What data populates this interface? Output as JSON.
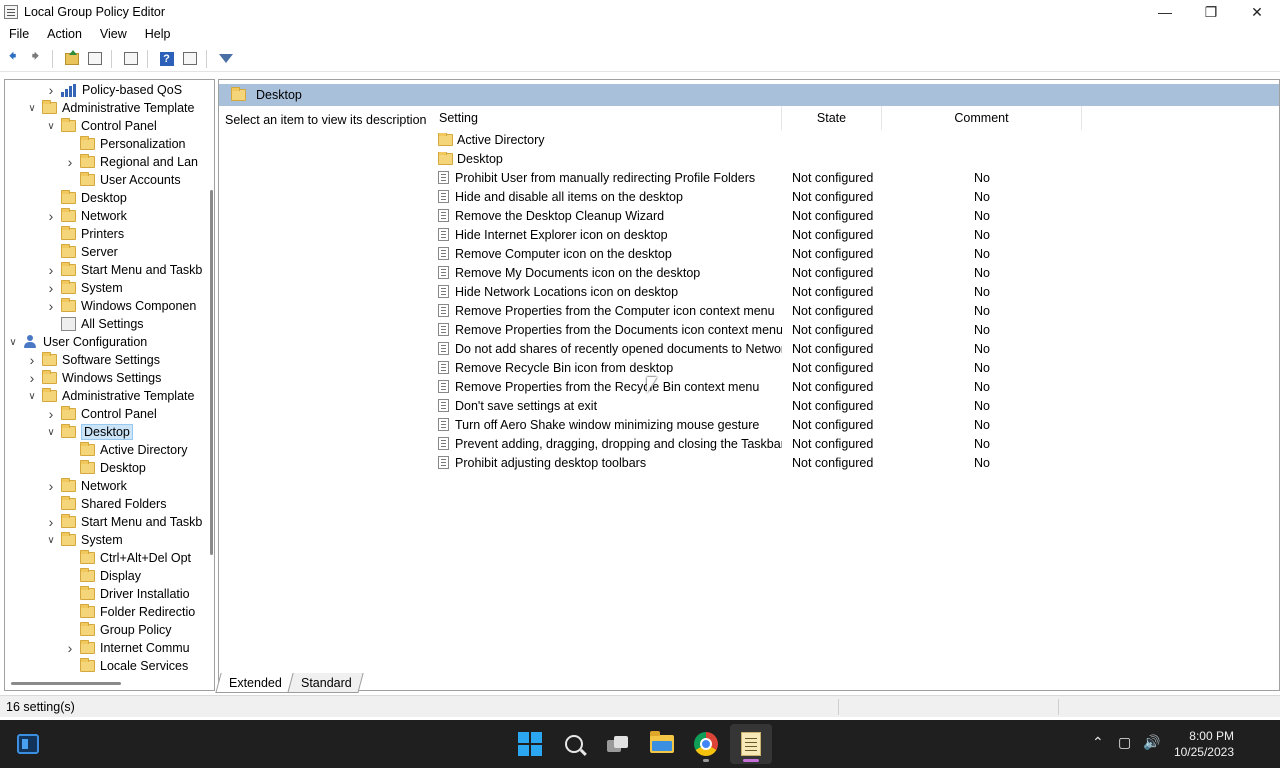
{
  "window": {
    "title": "Local Group Policy Editor"
  },
  "menu": [
    "File",
    "Action",
    "View",
    "Help"
  ],
  "tree": [
    {
      "label": "Policy-based QoS",
      "depth": 2,
      "chev": "right",
      "icon": "bars"
    },
    {
      "label": "Administrative Template",
      "depth": 1,
      "chev": "down",
      "icon": "folder"
    },
    {
      "label": "Control Panel",
      "depth": 2,
      "chev": "down",
      "icon": "folder"
    },
    {
      "label": "Personalization",
      "depth": 3,
      "chev": "",
      "icon": "folder"
    },
    {
      "label": "Regional and Lan",
      "depth": 3,
      "chev": "right",
      "icon": "folder"
    },
    {
      "label": "User Accounts",
      "depth": 3,
      "chev": "",
      "icon": "folder"
    },
    {
      "label": "Desktop",
      "depth": 2,
      "chev": "",
      "icon": "folder"
    },
    {
      "label": "Network",
      "depth": 2,
      "chev": "right",
      "icon": "folder"
    },
    {
      "label": "Printers",
      "depth": 2,
      "chev": "",
      "icon": "folder"
    },
    {
      "label": "Server",
      "depth": 2,
      "chev": "",
      "icon": "folder"
    },
    {
      "label": "Start Menu and Taskb",
      "depth": 2,
      "chev": "right",
      "icon": "folder"
    },
    {
      "label": "System",
      "depth": 2,
      "chev": "right",
      "icon": "folder"
    },
    {
      "label": "Windows Componen",
      "depth": 2,
      "chev": "right",
      "icon": "folder"
    },
    {
      "label": "All Settings",
      "depth": 2,
      "chev": "",
      "icon": "allsettings"
    },
    {
      "label": "User Configuration",
      "depth": 0,
      "chev": "down",
      "icon": "user"
    },
    {
      "label": "Software Settings",
      "depth": 1,
      "chev": "right",
      "icon": "folder"
    },
    {
      "label": "Windows Settings",
      "depth": 1,
      "chev": "right",
      "icon": "folder"
    },
    {
      "label": "Administrative Template",
      "depth": 1,
      "chev": "down",
      "icon": "folder"
    },
    {
      "label": "Control Panel",
      "depth": 2,
      "chev": "right",
      "icon": "folder"
    },
    {
      "label": "Desktop",
      "depth": 2,
      "chev": "down",
      "icon": "folder",
      "selected": true
    },
    {
      "label": "Active Directory",
      "depth": 3,
      "chev": "",
      "icon": "folder"
    },
    {
      "label": "Desktop",
      "depth": 3,
      "chev": "",
      "icon": "folder"
    },
    {
      "label": "Network",
      "depth": 2,
      "chev": "right",
      "icon": "folder"
    },
    {
      "label": "Shared Folders",
      "depth": 2,
      "chev": "",
      "icon": "folder"
    },
    {
      "label": "Start Menu and Taskb",
      "depth": 2,
      "chev": "right",
      "icon": "folder"
    },
    {
      "label": "System",
      "depth": 2,
      "chev": "down",
      "icon": "folder"
    },
    {
      "label": "Ctrl+Alt+Del Opt",
      "depth": 3,
      "chev": "",
      "icon": "folder"
    },
    {
      "label": "Display",
      "depth": 3,
      "chev": "",
      "icon": "folder"
    },
    {
      "label": "Driver Installatio",
      "depth": 3,
      "chev": "",
      "icon": "folder"
    },
    {
      "label": "Folder Redirectio",
      "depth": 3,
      "chev": "",
      "icon": "folder"
    },
    {
      "label": "Group Policy",
      "depth": 3,
      "chev": "",
      "icon": "folder"
    },
    {
      "label": "Internet Commu",
      "depth": 3,
      "chev": "right",
      "icon": "folder"
    },
    {
      "label": "Locale Services",
      "depth": 3,
      "chev": "",
      "icon": "folder"
    }
  ],
  "right_pane": {
    "header": "Desktop",
    "description": "Select an item to view its description.",
    "columns": {
      "setting": "Setting",
      "state": "State",
      "comment": "Comment"
    },
    "rows": [
      {
        "type": "folder",
        "setting": "Active Directory",
        "state": "",
        "comment": ""
      },
      {
        "type": "folder",
        "setting": "Desktop",
        "state": "",
        "comment": ""
      },
      {
        "type": "policy",
        "setting": "Prohibit User from manually redirecting Profile Folders",
        "state": "Not configured",
        "comment": "No"
      },
      {
        "type": "policy",
        "setting": "Hide and disable all items on the desktop",
        "state": "Not configured",
        "comment": "No"
      },
      {
        "type": "policy",
        "setting": "Remove the Desktop Cleanup Wizard",
        "state": "Not configured",
        "comment": "No"
      },
      {
        "type": "policy",
        "setting": "Hide Internet Explorer icon on desktop",
        "state": "Not configured",
        "comment": "No"
      },
      {
        "type": "policy",
        "setting": "Remove Computer icon on the desktop",
        "state": "Not configured",
        "comment": "No"
      },
      {
        "type": "policy",
        "setting": "Remove My Documents icon on the desktop",
        "state": "Not configured",
        "comment": "No"
      },
      {
        "type": "policy",
        "setting": "Hide Network Locations icon on desktop",
        "state": "Not configured",
        "comment": "No"
      },
      {
        "type": "policy",
        "setting": "Remove Properties from the Computer icon context menu",
        "state": "Not configured",
        "comment": "No"
      },
      {
        "type": "policy",
        "setting": "Remove Properties from the Documents icon context menu",
        "state": "Not configured",
        "comment": "No"
      },
      {
        "type": "policy",
        "setting": "Do not add shares of recently opened documents to Networ...",
        "state": "Not configured",
        "comment": "No"
      },
      {
        "type": "policy",
        "setting": "Remove Recycle Bin icon from desktop",
        "state": "Not configured",
        "comment": "No"
      },
      {
        "type": "policy",
        "setting": "Remove Properties from the Recycle Bin context menu",
        "state": "Not configured",
        "comment": "No"
      },
      {
        "type": "policy",
        "setting": "Don't save settings at exit",
        "state": "Not configured",
        "comment": "No"
      },
      {
        "type": "policy",
        "setting": "Turn off Aero Shake window minimizing mouse gesture",
        "state": "Not configured",
        "comment": "No"
      },
      {
        "type": "policy",
        "setting": "Prevent adding, dragging, dropping and closing the Taskbar...",
        "state": "Not configured",
        "comment": "No"
      },
      {
        "type": "policy",
        "setting": "Prohibit adjusting desktop toolbars",
        "state": "Not configured",
        "comment": "No"
      }
    ]
  },
  "tabs": [
    "Extended",
    "Standard"
  ],
  "status": {
    "text": "16 setting(s)"
  },
  "taskbar": {
    "time": "8:00 PM",
    "date": "10/25/2023",
    "icons": [
      "widgets-icon",
      "start-icon",
      "search-icon",
      "task-view-icon",
      "file-explorer-icon",
      "chrome-icon",
      "group-policy-editor-icon"
    ]
  },
  "colors": {
    "header_band": "#a9c0db",
    "selection": "#cce4f7",
    "taskbar": "#1f1f1f",
    "accent": "#2aa7f0"
  }
}
